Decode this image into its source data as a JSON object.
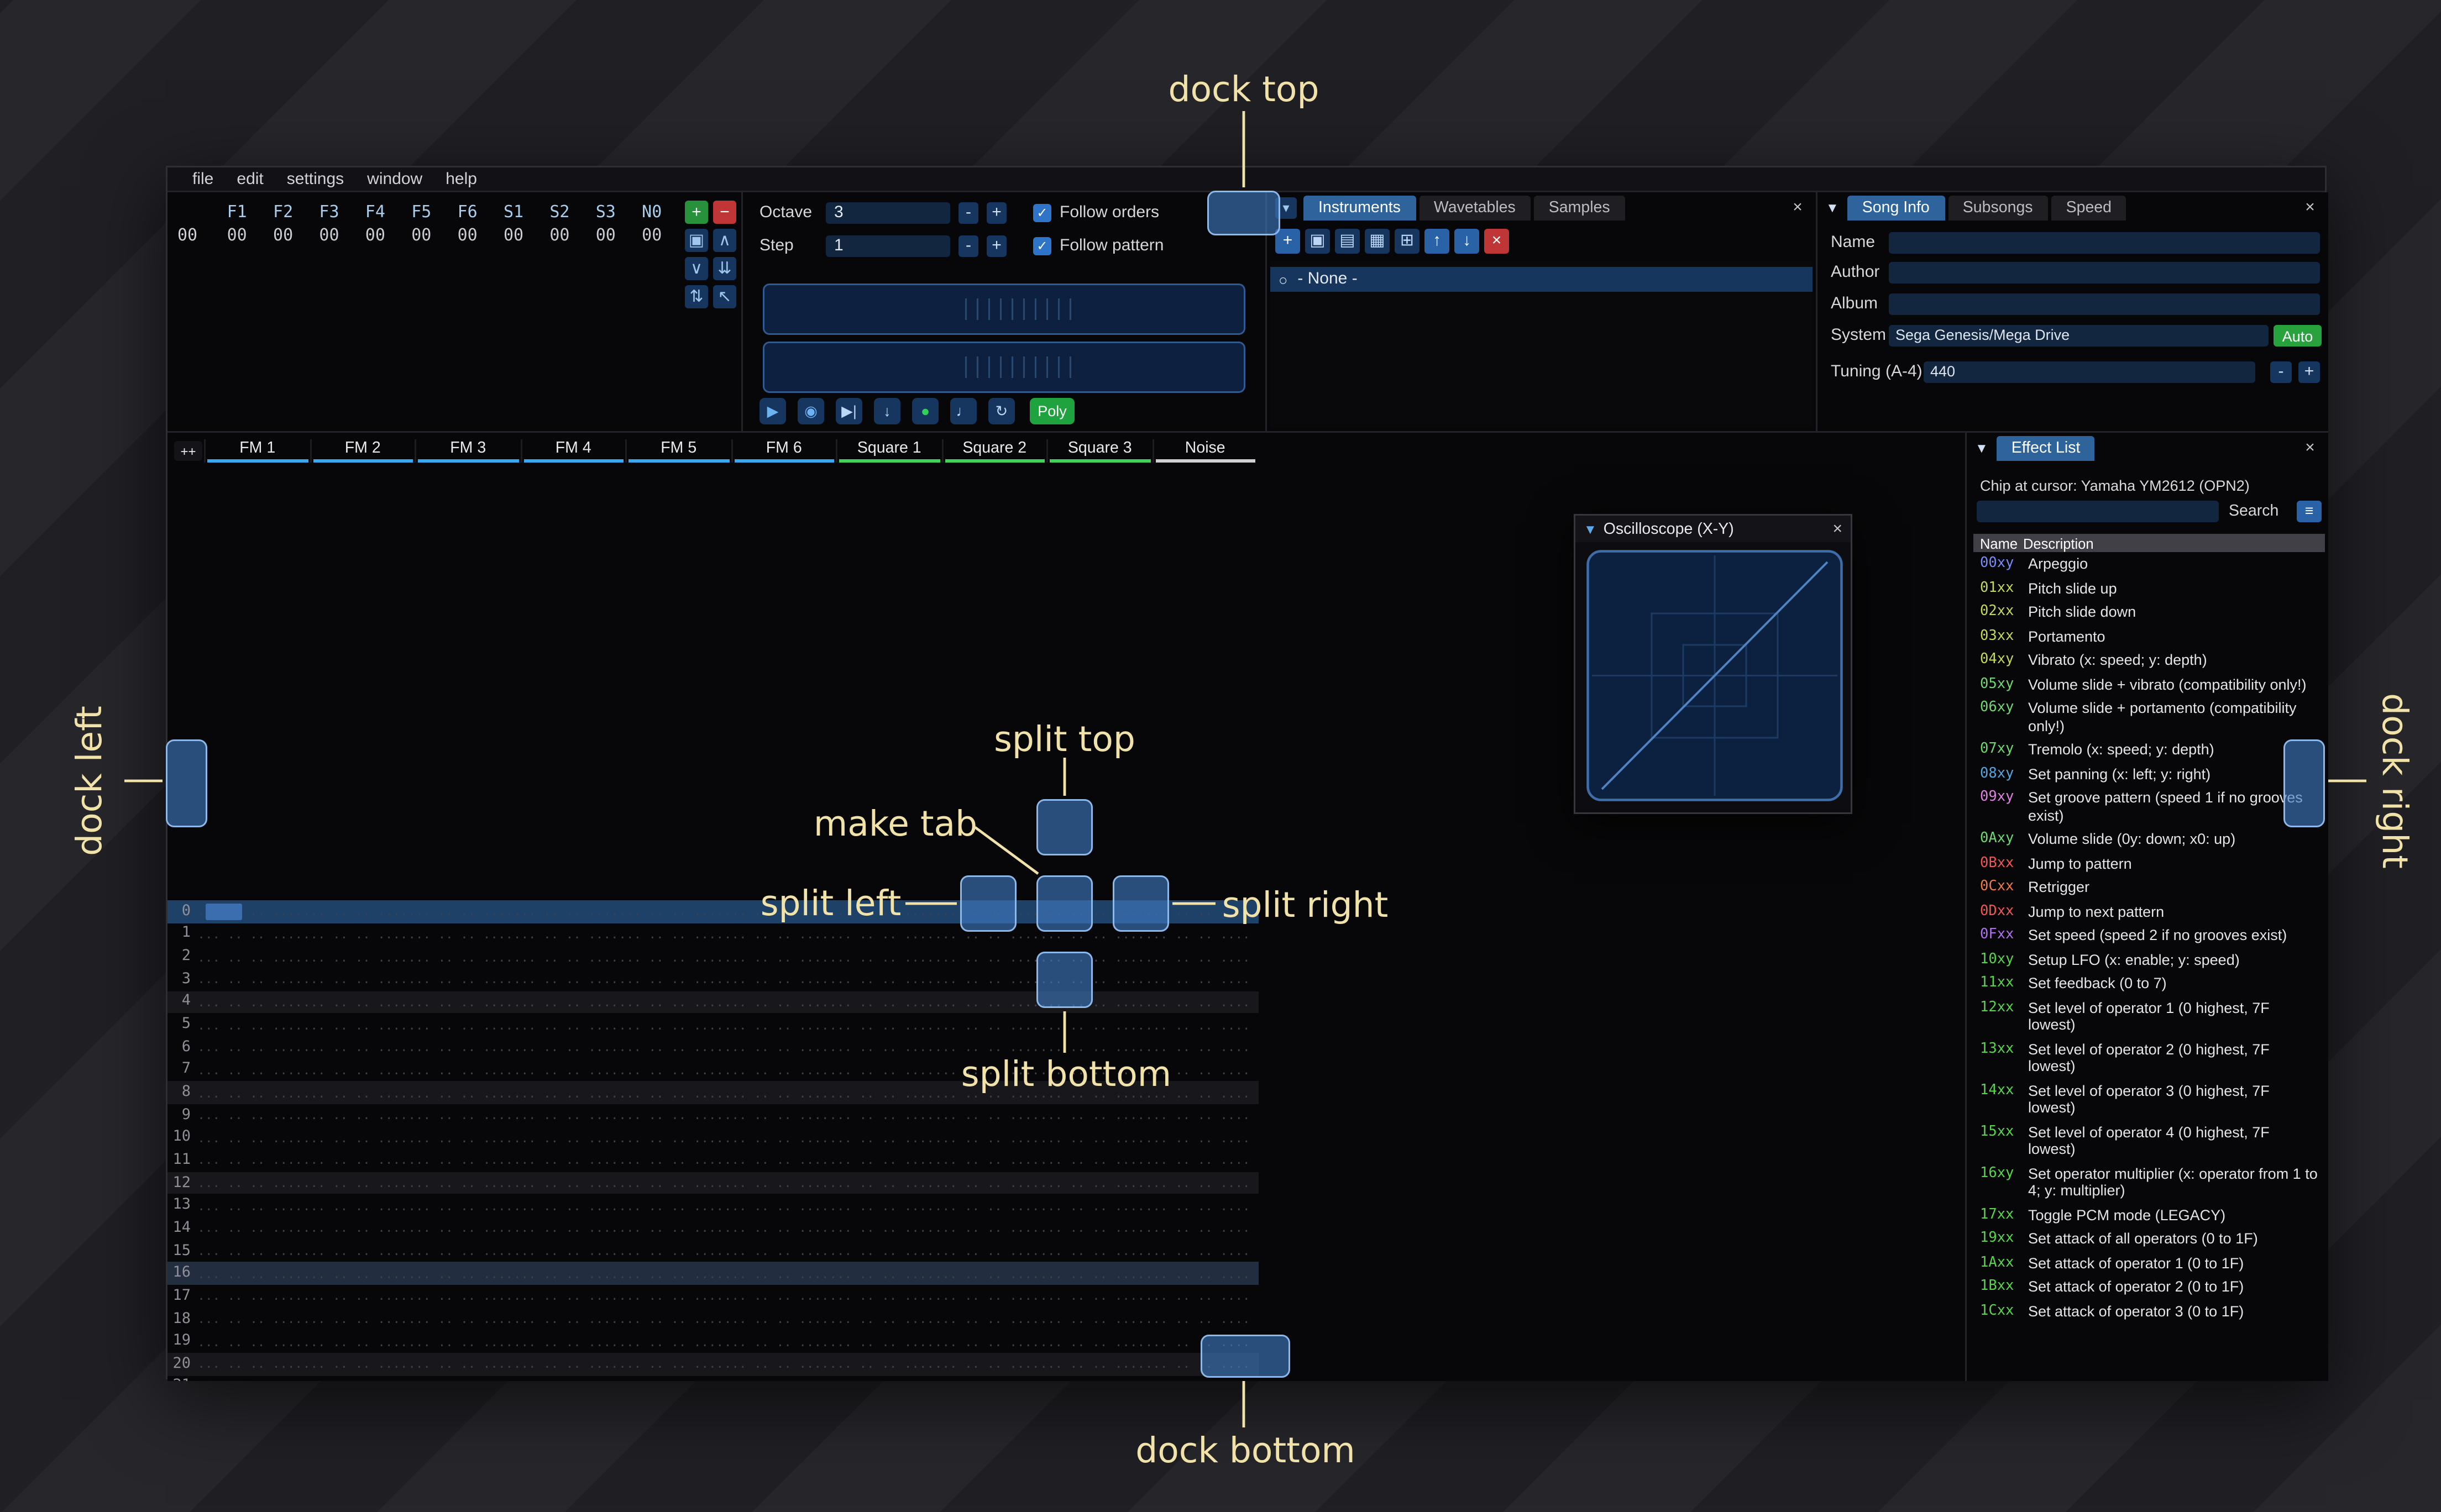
{
  "icons": {
    "caret_down": "▾",
    "collapse": "▼",
    "close": "×",
    "radio": "○",
    "hamburger": "≡",
    "check": "✓"
  },
  "menu": {
    "items": [
      "file",
      "edit",
      "settings",
      "window",
      "help"
    ]
  },
  "orders": {
    "row_label": "00",
    "columns": [
      "F1",
      "F2",
      "F3",
      "F4",
      "F5",
      "F6",
      "S1",
      "S2",
      "S3",
      "N0"
    ],
    "values": [
      "00",
      "00",
      "00",
      "00",
      "00",
      "00",
      "00",
      "00",
      "00",
      "00"
    ],
    "buttons": [
      {
        "name": "add-order",
        "glyph": "+",
        "kind": "green"
      },
      {
        "name": "remove-order",
        "glyph": "−",
        "kind": "red"
      },
      {
        "name": "duplicate-order",
        "glyph": "▣",
        "kind": "blue"
      },
      {
        "name": "move-order-up",
        "glyph": "∧",
        "kind": "blue"
      },
      {
        "name": "move-order-down",
        "glyph": "∨",
        "kind": "blue"
      },
      {
        "name": "duplicate-order-to-end",
        "glyph": "⇊",
        "kind": "blue"
      },
      {
        "name": "order-change-mode",
        "glyph": "⇅",
        "kind": "blue"
      },
      {
        "name": "order-edit-mode",
        "glyph": "↖",
        "kind": "blue"
      }
    ]
  },
  "controls": {
    "octave_label": "Octave",
    "octave_value": "3",
    "step_label": "Step",
    "step_value": "1",
    "minus": "-",
    "plus": "+",
    "follow_orders": "Follow orders",
    "follow_pattern": "Follow pattern",
    "transport": [
      {
        "name": "play",
        "glyph": "▶",
        "color": "#6db2f2"
      },
      {
        "name": "play-pattern",
        "glyph": "◉",
        "color": "#6db2f2"
      },
      {
        "name": "play-from-cursor",
        "glyph": "▶|",
        "color": "#bcd7f5"
      },
      {
        "name": "step-one-row",
        "glyph": "↓",
        "color": "#bcd7f5"
      },
      {
        "name": "edit-record",
        "glyph": "●",
        "color": "#35d05a"
      },
      {
        "name": "metronome",
        "glyph": "♩",
        "color": "#bcd7f5"
      },
      {
        "name": "repeat-pattern",
        "glyph": "↻",
        "color": "#bcd7f5"
      }
    ],
    "poly_label": "Poly"
  },
  "instruments": {
    "tabs": [
      "Instruments",
      "Wavetables",
      "Samples"
    ],
    "selected_tab": "Instruments",
    "toolbar": [
      {
        "name": "add-instrument",
        "glyph": "+",
        "kind": "blue"
      },
      {
        "name": "duplicate-instrument",
        "glyph": "▣",
        "kind": "dark"
      },
      {
        "name": "open-instrument",
        "glyph": "▤",
        "kind": "dark"
      },
      {
        "name": "save-instrument",
        "glyph": "▦",
        "kind": "dark"
      },
      {
        "name": "instrument-folders",
        "glyph": "⊞",
        "kind": "dark"
      },
      {
        "name": "move-instrument-up",
        "glyph": "↑",
        "kind": "blue"
      },
      {
        "name": "move-instrument-down",
        "glyph": "↓",
        "kind": "blue"
      },
      {
        "name": "delete-instrument",
        "glyph": "×",
        "kind": "red"
      }
    ],
    "list_item": "- None -"
  },
  "song_info": {
    "tabs": [
      "Song Info",
      "Subsongs",
      "Speed"
    ],
    "selected_tab": "Song Info",
    "fields": [
      {
        "label": "Name",
        "value": ""
      },
      {
        "label": "Author",
        "value": ""
      },
      {
        "label": "Album",
        "value": ""
      }
    ],
    "system_label": "System",
    "system_value": "Sega Genesis/Mega Drive",
    "auto_label": "Auto",
    "tuning_label": "Tuning (A-4)",
    "tuning_value": "440"
  },
  "pattern": {
    "corner_label": "++",
    "channels": [
      {
        "name": "FM 1",
        "color": "#38a8f0"
      },
      {
        "name": "FM 2",
        "color": "#38a8f0"
      },
      {
        "name": "FM 3",
        "color": "#38a8f0"
      },
      {
        "name": "FM 4",
        "color": "#38a8f0"
      },
      {
        "name": "FM 5",
        "color": "#38a8f0"
      },
      {
        "name": "FM 6",
        "color": "#38a8f0"
      },
      {
        "name": "Square 1",
        "color": "#3fd35a"
      },
      {
        "name": "Square 2",
        "color": "#3fd35a"
      },
      {
        "name": "Square 3",
        "color": "#3fd35a"
      },
      {
        "name": "Noise",
        "color": "#d0d0d0"
      }
    ],
    "row_count": 22,
    "empty_cell": "... .. .. ....",
    "cursor_row": 0
  },
  "oscilloscope": {
    "title": "Oscilloscope (X-Y)"
  },
  "effect_list": {
    "title": "Effect List",
    "chip_line": "Chip at cursor: Yamaha YM2612 (OPN2)",
    "search_label": "Search",
    "name_header": "Name",
    "description_header": "Description",
    "effects": [
      {
        "code": "00xy",
        "color": "#7b8cf8",
        "desc": "Arpeggio"
      },
      {
        "code": "01xx",
        "color": "#c6d957",
        "desc": "Pitch slide up"
      },
      {
        "code": "02xx",
        "color": "#c6d957",
        "desc": "Pitch slide down"
      },
      {
        "code": "03xx",
        "color": "#c6d957",
        "desc": "Portamento"
      },
      {
        "code": "04xy",
        "color": "#c6d957",
        "desc": "Vibrato (x: speed; y: depth)"
      },
      {
        "code": "05xy",
        "color": "#6fd96f",
        "desc": "Volume slide + vibrato (compatibility only!)"
      },
      {
        "code": "06xy",
        "color": "#6fd96f",
        "desc": "Volume slide + portamento (compatibility only!)"
      },
      {
        "code": "07xy",
        "color": "#6fd96f",
        "desc": "Tremolo (x: speed; y: depth)"
      },
      {
        "code": "08xy",
        "color": "#53a5e0",
        "desc": "Set panning (x: left; y: right)"
      },
      {
        "code": "09xy",
        "color": "#e080e0",
        "desc": "Set groove pattern (speed 1 if no grooves exist)"
      },
      {
        "code": "0Axy",
        "color": "#6fd96f",
        "desc": "Volume slide (0y: down; x0: up)"
      },
      {
        "code": "0Bxx",
        "color": "#f25555",
        "desc": "Jump to pattern"
      },
      {
        "code": "0Cxx",
        "color": "#f07848",
        "desc": "Retrigger"
      },
      {
        "code": "0Dxx",
        "color": "#f25555",
        "desc": "Jump to next pattern"
      },
      {
        "code": "0Fxx",
        "color": "#b070f0",
        "desc": "Set speed (speed 2 if no grooves exist)"
      },
      {
        "code": "10xy",
        "color": "#55d748",
        "desc": "Setup LFO (x: enable; y: speed)"
      },
      {
        "code": "11xx",
        "color": "#55d748",
        "desc": "Set feedback (0 to 7)"
      },
      {
        "code": "12xx",
        "color": "#55d748",
        "desc": "Set level of operator 1 (0 highest, 7F lowest)"
      },
      {
        "code": "13xx",
        "color": "#55d748",
        "desc": "Set level of operator 2 (0 highest, 7F lowest)"
      },
      {
        "code": "14xx",
        "color": "#55d748",
        "desc": "Set level of operator 3 (0 highest, 7F lowest)"
      },
      {
        "code": "15xx",
        "color": "#55d748",
        "desc": "Set level of operator 4 (0 highest, 7F lowest)"
      },
      {
        "code": "16xy",
        "color": "#55d748",
        "desc": "Set operator multiplier (x: operator from 1 to 4; y: multiplier)"
      },
      {
        "code": "17xx",
        "color": "#55d748",
        "desc": "Toggle PCM mode (LEGACY)"
      },
      {
        "code": "19xx",
        "color": "#55d748",
        "desc": "Set attack of all operators (0 to 1F)"
      },
      {
        "code": "1Axx",
        "color": "#55d748",
        "desc": "Set attack of operator 1 (0 to 1F)"
      },
      {
        "code": "1Bxx",
        "color": "#55d748",
        "desc": "Set attack of operator 2 (0 to 1F)"
      },
      {
        "code": "1Cxx",
        "color": "#55d748",
        "desc": "Set attack of operator 3 (0 to 1F)"
      }
    ]
  },
  "dock_overlay": {
    "dock_top": "dock top",
    "dock_bottom": "dock bottom",
    "dock_left": "dock left",
    "dock_right": "dock right",
    "split_top": "split top",
    "split_bottom": "split bottom",
    "split_left": "split left",
    "split_right": "split right",
    "make_tab": "make tab",
    "annotation_color": "#f1e2a9"
  }
}
